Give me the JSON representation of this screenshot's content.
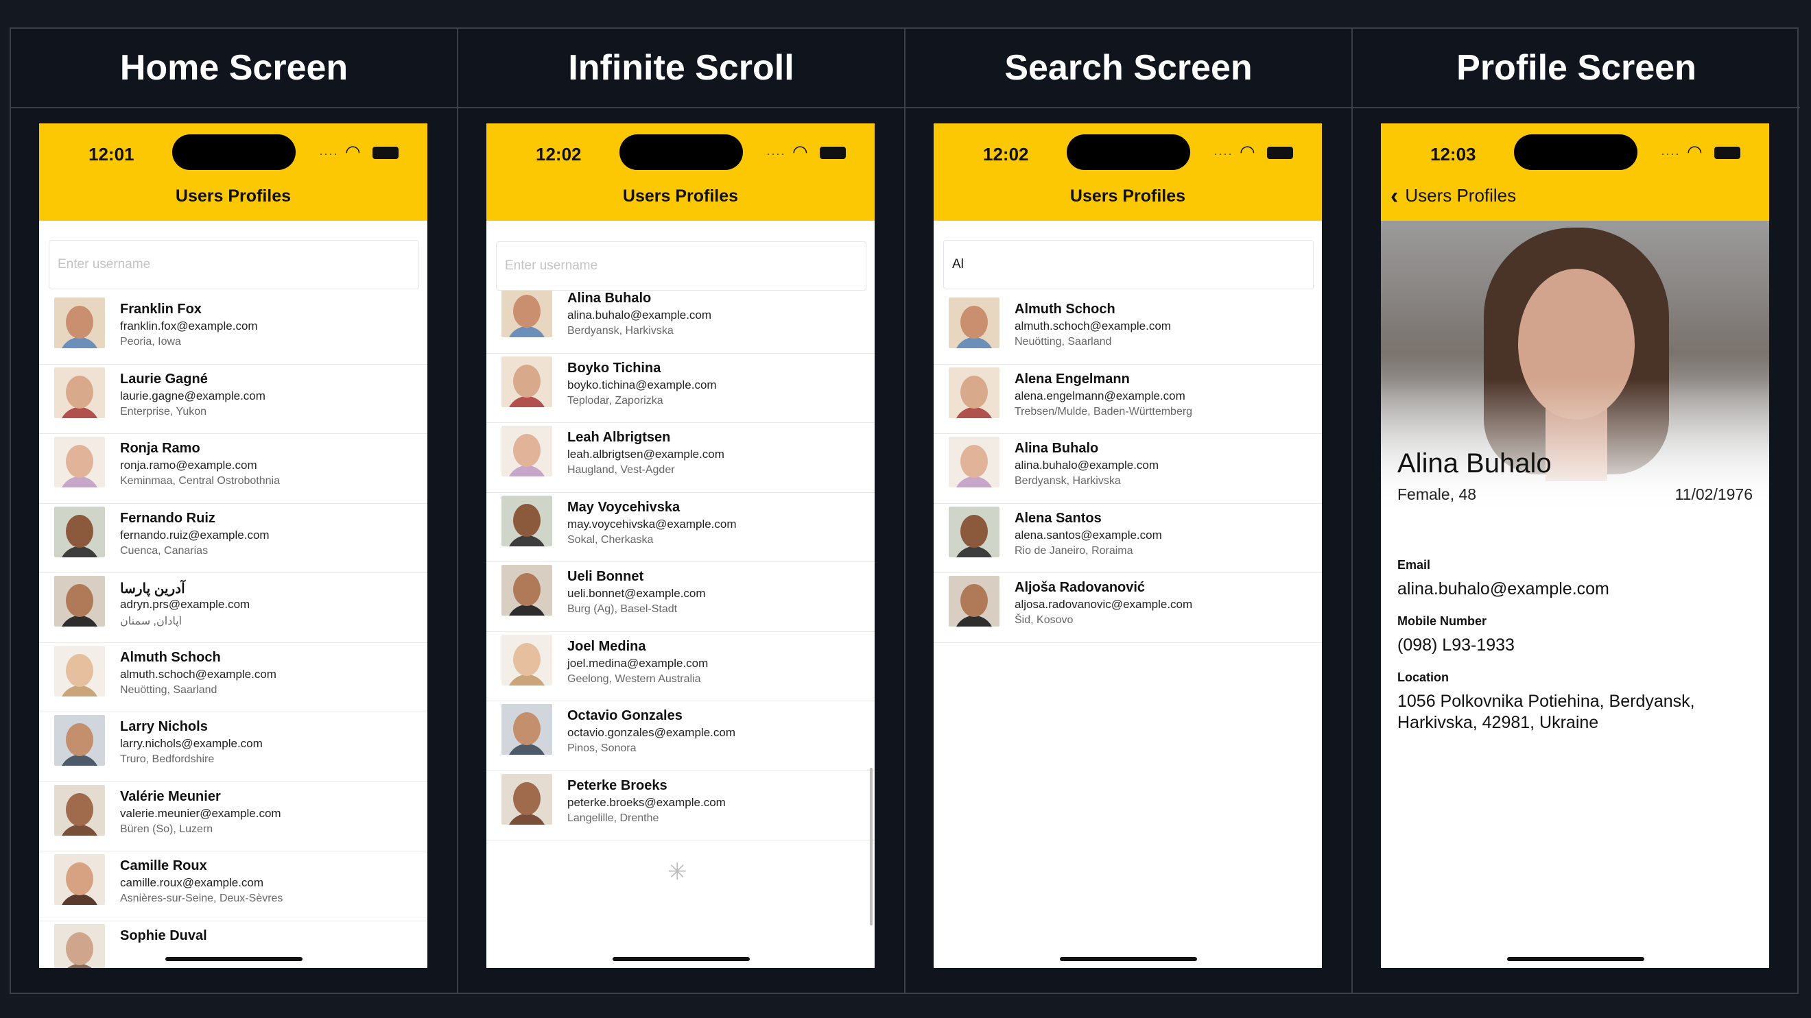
{
  "columns": [
    {
      "title": "Home Screen"
    },
    {
      "title": "Infinite Scroll"
    },
    {
      "title": "Search Screen"
    },
    {
      "title": "Profile Screen"
    }
  ],
  "home": {
    "time": "12:01",
    "nav_title": "Users Profiles",
    "search_placeholder": "Enter username",
    "users": [
      {
        "name": "Franklin Fox",
        "email": "franklin.fox@example.com",
        "location": "Peoria, Iowa"
      },
      {
        "name": "Laurie Gagné",
        "email": "laurie.gagne@example.com",
        "location": "Enterprise, Yukon"
      },
      {
        "name": "Ronja Ramo",
        "email": "ronja.ramo@example.com",
        "location": "Keminmaa, Central Ostrobothnia"
      },
      {
        "name": "Fernando Ruiz",
        "email": "fernando.ruiz@example.com",
        "location": "Cuenca, Canarias"
      },
      {
        "name": "آدرین پارسا",
        "email": "adryn.prs@example.com",
        "location": "اپادان, سمنان"
      },
      {
        "name": "Almuth Schoch",
        "email": "almuth.schoch@example.com",
        "location": "Neuötting, Saarland"
      },
      {
        "name": "Larry Nichols",
        "email": "larry.nichols@example.com",
        "location": "Truro, Bedfordshire"
      },
      {
        "name": "Valérie Meunier",
        "email": "valerie.meunier@example.com",
        "location": "Büren (So), Luzern"
      },
      {
        "name": "Camille Roux",
        "email": "camille.roux@example.com",
        "location": "Asnières-sur-Seine, Deux-Sèvres"
      },
      {
        "name": "Sophie Duval",
        "email": "",
        "location": ""
      }
    ]
  },
  "scroll": {
    "time": "12:02",
    "nav_title": "Users Profiles",
    "search_placeholder": "Enter username",
    "users": [
      {
        "name": "Alina Buhalo",
        "email": "alina.buhalo@example.com",
        "location": "Berdyansk, Harkivska"
      },
      {
        "name": "Boyko Tichina",
        "email": "boyko.tichina@example.com",
        "location": "Teplodar, Zaporizka"
      },
      {
        "name": "Leah Albrigtsen",
        "email": "leah.albrigtsen@example.com",
        "location": "Haugland, Vest-Agder"
      },
      {
        "name": "May Voycehivska",
        "email": "may.voycehivska@example.com",
        "location": "Sokal, Cherkaska"
      },
      {
        "name": "Ueli Bonnet",
        "email": "ueli.bonnet@example.com",
        "location": "Burg (Ag), Basel-Stadt"
      },
      {
        "name": "Joel Medina",
        "email": "joel.medina@example.com",
        "location": "Geelong, Western Australia"
      },
      {
        "name": "Octavio Gonzales",
        "email": "octavio.gonzales@example.com",
        "location": "Pinos, Sonora"
      },
      {
        "name": "Peterke Broeks",
        "email": "peterke.broeks@example.com",
        "location": "Langelille, Drenthe"
      }
    ]
  },
  "search": {
    "time": "12:02",
    "nav_title": "Users Profiles",
    "query": "Al",
    "users": [
      {
        "name": "Almuth Schoch",
        "email": "almuth.schoch@example.com",
        "location": "Neuötting, Saarland"
      },
      {
        "name": "Alena Engelmann",
        "email": "alena.engelmann@example.com",
        "location": "Trebsen/Mulde, Baden-Württemberg"
      },
      {
        "name": "Alina Buhalo",
        "email": "alina.buhalo@example.com",
        "location": "Berdyansk, Harkivska"
      },
      {
        "name": "Alena Santos",
        "email": "alena.santos@example.com",
        "location": "Rio de Janeiro, Roraima"
      },
      {
        "name": "Aljoša Radovanović",
        "email": "aljosa.radovanovic@example.com",
        "location": "Šid, Kosovo"
      }
    ]
  },
  "profile": {
    "time": "12:03",
    "back_label": "Users Profiles",
    "name": "Alina Buhalo",
    "gender_age": "Female, 48",
    "dob": "11/02/1976",
    "email_label": "Email",
    "email": "alina.buhalo@example.com",
    "mobile_label": "Mobile Number",
    "mobile": "(098) L93-1933",
    "location_label": "Location",
    "location": "1056 Polkovnika Potiehina, Berdyansk, Harkivska, 42981, Ukraine"
  },
  "colors": {
    "accent": "#fbc803",
    "frame_bg": "#10141c",
    "border": "#3a3f48"
  }
}
